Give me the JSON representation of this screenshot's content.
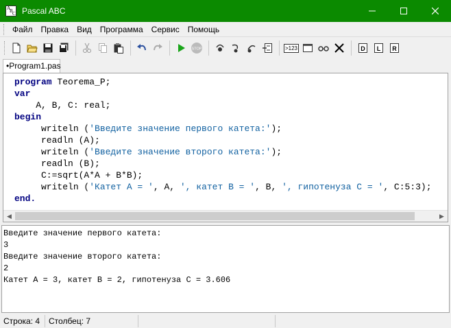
{
  "window": {
    "title": "Pascal ABC",
    "icon_letters": [
      "A",
      "B",
      "C"
    ]
  },
  "menu": {
    "items": [
      "Файл",
      "Правка",
      "Вид",
      "Программа",
      "Сервис",
      "Помощь"
    ]
  },
  "toolbar": {
    "groups": [
      [
        "new-file-icon",
        "open-folder-icon",
        "save-icon",
        "save-all-icon"
      ],
      [
        "cut-icon",
        "copy-icon",
        "paste-icon"
      ],
      [
        "undo-icon",
        "redo-icon"
      ],
      [
        "run-icon",
        "stop-icon"
      ],
      [
        "step-into-icon",
        "step-over-icon",
        "step-out-icon",
        "run-to-cursor-icon"
      ],
      [
        "watch-icon",
        "output-window-icon",
        "breakpoint-icon",
        "close-icon"
      ],
      [
        "debug-d-icon",
        "debug-l-icon",
        "debug-r-icon"
      ]
    ],
    "watch_label": ">123"
  },
  "tabs": [
    {
      "label": "•Program1.pas",
      "active": true
    }
  ],
  "editor": {
    "lines": [
      [
        {
          "t": "program",
          "c": "kw"
        },
        {
          "t": " Teorema_P;",
          "c": ""
        }
      ],
      [
        {
          "t": "var",
          "c": "kw"
        }
      ],
      [
        {
          "t": "    A, B, C: real;",
          "c": ""
        }
      ],
      [
        {
          "t": "begin",
          "c": "kw"
        }
      ],
      [
        {
          "t": "     writeln (",
          "c": ""
        },
        {
          "t": "'Введите значение первого катета:'",
          "c": "str"
        },
        {
          "t": ");",
          "c": ""
        }
      ],
      [
        {
          "t": "     readln (A);",
          "c": ""
        }
      ],
      [
        {
          "t": "     writeln (",
          "c": ""
        },
        {
          "t": "'Введите значение второго катета:'",
          "c": "str"
        },
        {
          "t": ");",
          "c": ""
        }
      ],
      [
        {
          "t": "     readln (B);",
          "c": ""
        }
      ],
      [
        {
          "t": "     C:=sqrt(A*A + B*B);",
          "c": ""
        }
      ],
      [
        {
          "t": "     writeln (",
          "c": ""
        },
        {
          "t": "'Катет A = '",
          "c": "str"
        },
        {
          "t": ", A, ",
          "c": ""
        },
        {
          "t": "', катет B = '",
          "c": "str"
        },
        {
          "t": ", B, ",
          "c": ""
        },
        {
          "t": "', гипотенуза C = '",
          "c": "str"
        },
        {
          "t": ", C:5:3);",
          "c": ""
        }
      ],
      [
        {
          "t": "end.",
          "c": "kw"
        }
      ]
    ]
  },
  "output": {
    "lines": [
      "Введите значение первого катета:",
      "3",
      "Введите значение второго катета:",
      "2",
      "Катет A = 3, катет B = 2, гипотенуза C = 3.606"
    ]
  },
  "status": {
    "row": "Строка: 4",
    "col": "Столбец: 7"
  },
  "colors": {
    "titlebar": "#0b8a00",
    "keyword": "#000080",
    "string": "#1060a0"
  }
}
